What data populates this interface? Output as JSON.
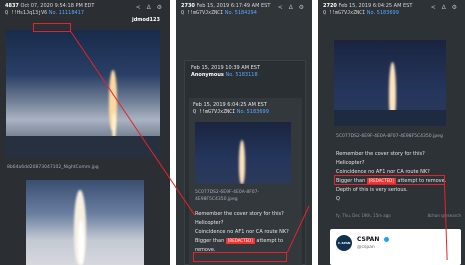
{
  "post1": {
    "id": "4837",
    "date": "Oct 07, 2020 9:54:18 PM EDT",
    "trip": "Q !!Hs1Jq13jV6",
    "no": "No. 11118417",
    "author": "jdmod123",
    "filename": "8b64a6dd20873047102_NightComm.jpg",
    "header_icons": "< ∆ ⚙"
  },
  "post2": {
    "id": "2730",
    "date": "Feb 15, 2019 6:17:49 AM EST",
    "trip": "Q !!mG7VJxZNCI",
    "no": "No. 5184294",
    "reply_date": "Feb 15, 2019 10:39 AM EST",
    "reply_name": "Anonymous",
    "reply_no": "No. 5183118",
    "inner_date": "Feb 15, 2019 6:04:25 AM EST",
    "inner_trip": "Q !!mG7VJxZNCI",
    "inner_no": "No. 5183699",
    "filename": "5C077DS2-6E9F-4E0A-8F07-4E98F5C4350.jpeg",
    "lines": [
      "Remember the cover story for this?",
      "Helicopter?",
      "Coincidence no AF1 nor CA route NK?",
      "Bigger than",
      "attempt to",
      "remove."
    ],
    "badge": "[REDACTED]",
    "header_icons": "< ∆ ⚙"
  },
  "post3": {
    "id": "2720",
    "date": "Feb 15, 2019 6:04:25 AM EST",
    "trip": "Q !!mG7VJxZNCI",
    "no": "No. 5183699",
    "filename": "5C077DS2-6E9F-4E0A-8F07-4E98F5C4350.jpeg",
    "lines": [
      "Remember the cover story for this?",
      "Helicopter?",
      "Coincidence no AF1 nor CA route NK?",
      "Bigger than",
      "attempt to remove.",
      "Depth of this is very serious.",
      "Q"
    ],
    "badge": "[REDACTED]",
    "footer_left": "fy, Thu, Dec 19th, 15m ago",
    "footer_right": "8chan qresearch",
    "header_icons": "< ∆ ⚙"
  },
  "tweet": {
    "name": "CSPAN",
    "handle": "@cspan",
    "logo_text": "C-SPAN"
  },
  "colors": {
    "highlight": "#e3232b",
    "link": "#5aa9ff"
  }
}
